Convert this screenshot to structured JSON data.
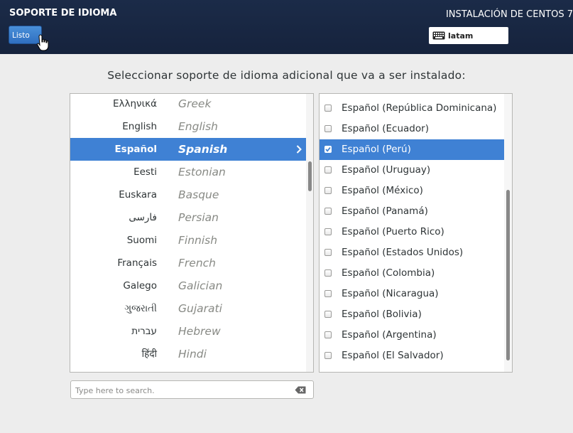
{
  "header": {
    "title": "SOPORTE DE IDIOMA",
    "done_label": "Listo",
    "install_title": "INSTALACIÓN DE CENTOS 7",
    "keyboard_layout": "latam"
  },
  "prompt": "Seleccionar soporte de idioma adicional que va a ser instalado:",
  "languages": [
    {
      "native": "Ελληνικά",
      "english": "Greek"
    },
    {
      "native": "English",
      "english": "English"
    },
    {
      "native": "Español",
      "english": "Spanish",
      "selected": true
    },
    {
      "native": "Eesti",
      "english": "Estonian"
    },
    {
      "native": "Euskara",
      "english": "Basque"
    },
    {
      "native": "فارسی",
      "english": "Persian"
    },
    {
      "native": "Suomi",
      "english": "Finnish"
    },
    {
      "native": "Français",
      "english": "French"
    },
    {
      "native": "Galego",
      "english": "Galician"
    },
    {
      "native": "ગુજરાતી",
      "english": "Gujarati"
    },
    {
      "native": "עברית",
      "english": "Hebrew"
    },
    {
      "native": "हिंदी",
      "english": "Hindi"
    }
  ],
  "locales": [
    {
      "label": "Español (República Dominicana)",
      "checked": false
    },
    {
      "label": "Español (Ecuador)",
      "checked": false
    },
    {
      "label": "Español (Perú)",
      "checked": true
    },
    {
      "label": "Español (Uruguay)",
      "checked": false
    },
    {
      "label": "Español (México)",
      "checked": false
    },
    {
      "label": "Español (Panamá)",
      "checked": false
    },
    {
      "label": "Español (Puerto Rico)",
      "checked": false
    },
    {
      "label": "Español (Estados Unidos)",
      "checked": false
    },
    {
      "label": "Español (Colombia)",
      "checked": false
    },
    {
      "label": "Español (Nicaragua)",
      "checked": false
    },
    {
      "label": "Español (Bolivia)",
      "checked": false
    },
    {
      "label": "Español (Argentina)",
      "checked": false
    },
    {
      "label": "Español (El Salvador)",
      "checked": false
    }
  ],
  "search": {
    "placeholder": "Type here to search.",
    "value": ""
  },
  "icons": {
    "cursor": "hand-pointer-icon",
    "keyboard": "keyboard-icon",
    "chevron": "chevron-right-icon",
    "check": "checkmark-icon",
    "clear": "clear-search-icon"
  },
  "colors": {
    "header_bg": "#1b2b48",
    "selection": "#3f81d4",
    "done_button": "#3a80cf",
    "background": "#ededed"
  }
}
